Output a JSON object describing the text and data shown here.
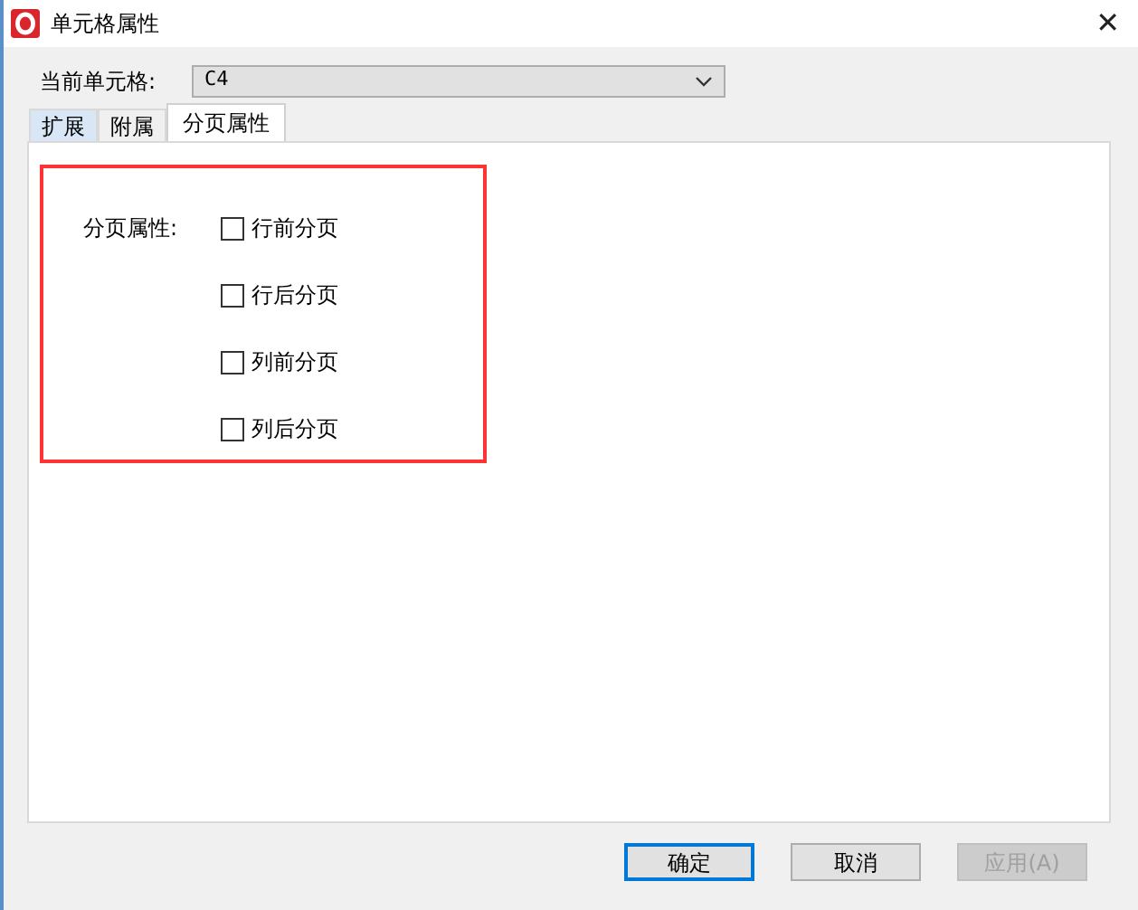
{
  "window": {
    "title": "单元格属性",
    "close": "✕"
  },
  "current_cell": {
    "label": "当前单元格:",
    "value": "C4"
  },
  "tabs": [
    {
      "label": "扩展",
      "selected": false,
      "hover": true
    },
    {
      "label": "附属",
      "selected": false,
      "hover": false
    },
    {
      "label": "分页属性",
      "selected": true,
      "hover": false
    }
  ],
  "page_break": {
    "label": "分页属性:",
    "options": [
      {
        "label": "行前分页",
        "checked": false
      },
      {
        "label": "行后分页",
        "checked": false
      },
      {
        "label": "列前分页",
        "checked": false
      },
      {
        "label": "列后分页",
        "checked": false
      }
    ]
  },
  "buttons": [
    {
      "label": "确定",
      "default": true,
      "disabled": false
    },
    {
      "label": "取消",
      "default": false,
      "disabled": false
    },
    {
      "label": "应用(A)",
      "default": false,
      "disabled": true
    }
  ]
}
